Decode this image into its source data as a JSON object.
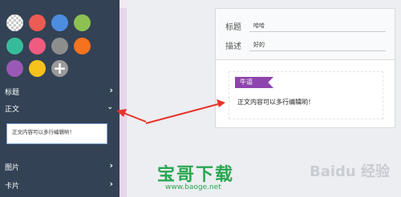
{
  "sidebar": {
    "swatches": [
      {
        "name": "transparent",
        "color": "#ffffff"
      },
      {
        "name": "red",
        "color": "#ec5b54"
      },
      {
        "name": "blue",
        "color": "#4d8de0"
      },
      {
        "name": "green",
        "color": "#8cc152"
      },
      {
        "name": "teal",
        "color": "#37bc9b"
      },
      {
        "name": "pink",
        "color": "#f05b80"
      },
      {
        "name": "gray",
        "color": "#8d8d8d"
      },
      {
        "name": "orange",
        "color": "#f5721f"
      },
      {
        "name": "purple",
        "color": "#9b59b6"
      },
      {
        "name": "yellow",
        "color": "#f6c21c"
      },
      {
        "name": "add",
        "color": "#9a9a9a"
      }
    ],
    "sections": {
      "title": "标题",
      "body": "正文",
      "image": "图片",
      "card": "卡片"
    },
    "body_text": "正文内容可以多行编辑哟！"
  },
  "card": {
    "title_label": "标题",
    "title_value": "哈哈",
    "desc_label": "描述",
    "desc_value": "好的",
    "ribbon": "牛逼",
    "body": "正文内容可以多行编辑哟！"
  },
  "watermark": {
    "brand": "宝哥下载",
    "url": "www.baoge.net",
    "baidu": "Baidu 经验"
  }
}
